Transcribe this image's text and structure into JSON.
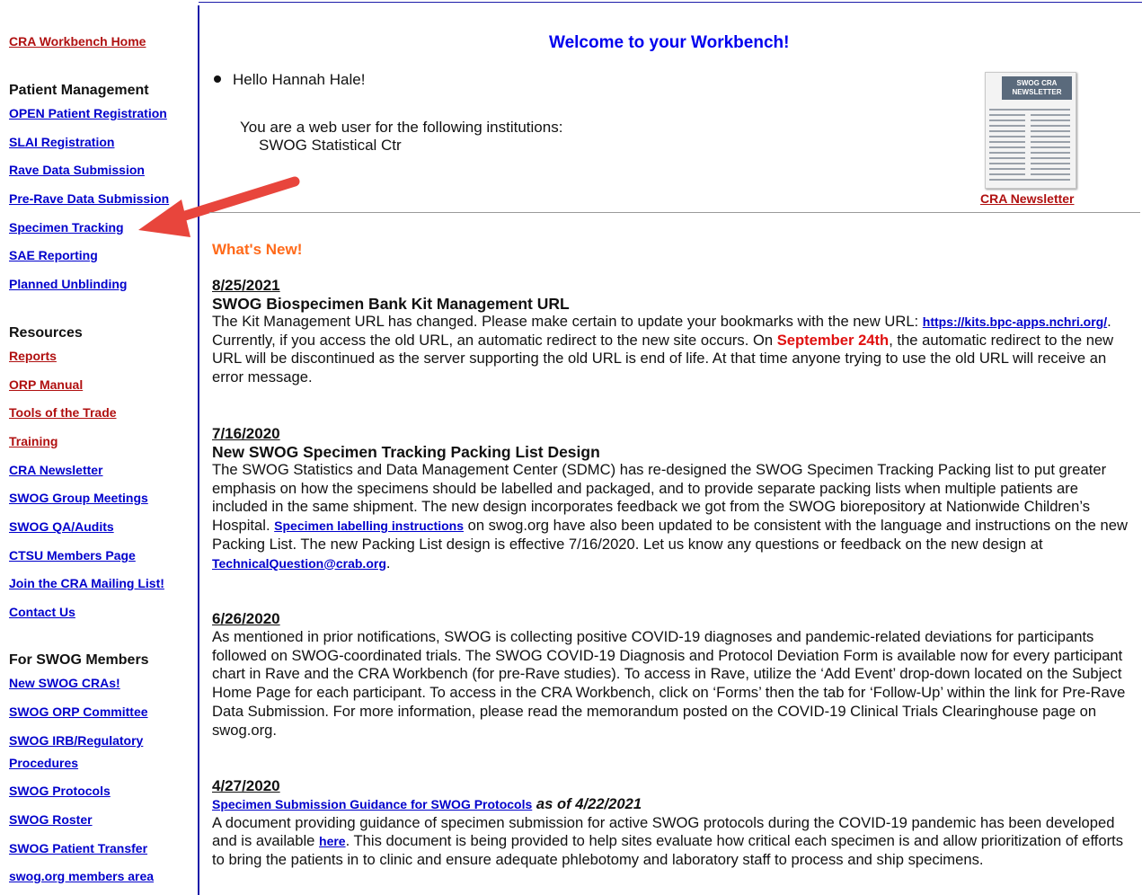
{
  "sidebar": {
    "home_link": "CRA Workbench Home",
    "patient_management": {
      "heading": "Patient Management",
      "links": [
        "OPEN Patient Registration",
        "SLAI Registration",
        "Rave Data Submission",
        "Pre-Rave Data Submission",
        "Specimen Tracking",
        "SAE Reporting",
        "Planned Unblinding"
      ]
    },
    "resources": {
      "heading": "Resources",
      "links_red": [
        "Reports",
        "ORP Manual",
        "Tools of the Trade",
        "Training"
      ],
      "links_blue": [
        "CRA Newsletter",
        "SWOG Group Meetings",
        "SWOG QA/Audits",
        "CTSU Members Page",
        "Join the CRA Mailing List!",
        "Contact Us"
      ]
    },
    "members": {
      "heading": "For SWOG Members",
      "links": [
        "New SWOG CRAs!",
        "SWOG ORP Committee",
        "SWOG IRB/Regulatory",
        "Procedures",
        "SWOG Protocols",
        "SWOG Roster",
        "SWOG Patient Transfer",
        "swog.org members area"
      ]
    }
  },
  "main": {
    "welcome": "Welcome to your Workbench!",
    "hello": "Hello Hannah Hale!",
    "web_user_text": "You are a web user for the following institutions:",
    "institution": "SWOG Statistical Ctr",
    "newsletter_thumb_label": "SWOG CRA NEWSLETTER",
    "newsletter_caption": "CRA Newsletter",
    "whats_new": "What's New!"
  },
  "news": [
    {
      "date": "8/25/2021",
      "title": "SWOG Biospecimen Bank Kit Management URL",
      "p1": "The Kit Management URL has changed. Please make certain to update your bookmarks with the new URL: ",
      "link": "https://kits.bpc-apps.nchri.org/",
      "p2": ". Currently, if you access the old URL, an automatic redirect to the new site occurs. On ",
      "highlight": "September 24th",
      "p3": ", the automatic redirect to the new URL will be discontinued as the server supporting the old URL is end of life. At that time anyone trying to use the old URL will receive an error message."
    },
    {
      "date": "7/16/2020",
      "title": "New SWOG Specimen Tracking Packing List Design",
      "p1": "The SWOG Statistics and Data Management Center (SDMC) has re-designed the SWOG Specimen Tracking Packing list to put greater emphasis on how the specimens should be labelled and packaged, and to provide separate packing lists when multiple patients are included in the same shipment. The new design incorporates feedback we got from the SWOG biorepository at Nationwide Children’s Hospital. ",
      "link1": "Specimen labelling instructions",
      "p2": " on swog.org have also been updated to be consistent with the language and instructions on the new Packing List. The new Packing List design is effective 7/16/2020. Let us know any questions or feedback on the new design at ",
      "link2": "TechnicalQuestion@crab.org",
      "p3": "."
    },
    {
      "date": "6/26/2020",
      "p1": "As mentioned in prior notifications, SWOG is collecting positive COVID-19 diagnoses and pandemic-related deviations for participants followed on SWOG-coordinated trials. The SWOG COVID-19 Diagnosis and Protocol Deviation Form is available now for every participant chart in Rave and the CRA Workbench (for pre-Rave studies). To access in Rave, utilize the ‘Add Event’ drop-down located on the Subject Home Page for each participant. To access in the CRA Workbench, click on ‘Forms’ then the tab for ‘Follow-Up’ within the link for Pre-Rave Data Submission. For more information, please read the memorandum posted on the COVID-19 Clinical Trials Clearinghouse page on swog.org."
    },
    {
      "date": "4/27/2020",
      "title_link": "Specimen Submission Guidance for SWOG Protocols",
      "title_suffix": " as of 4/22/2021",
      "p1": "A document providing guidance of specimen submission for active SWOG protocols during the COVID-19 pandemic has been developed and is available ",
      "link": "here",
      "p2": ". This document is being provided to help sites evaluate how critical each specimen is and allow prioritization of efforts to bring the patients in to clinic and ensure adequate phlebotomy and laboratory staff to process and ship specimens."
    }
  ],
  "colors": {
    "link_blue": "#0000cc",
    "link_red": "#b01010",
    "welcome_blue": "#0000ee",
    "whats_new_orange": "#ff6a1a",
    "highlight_red": "#e01010",
    "arrow_red": "#e8453c",
    "divider_blue": "#1a1aa8"
  }
}
